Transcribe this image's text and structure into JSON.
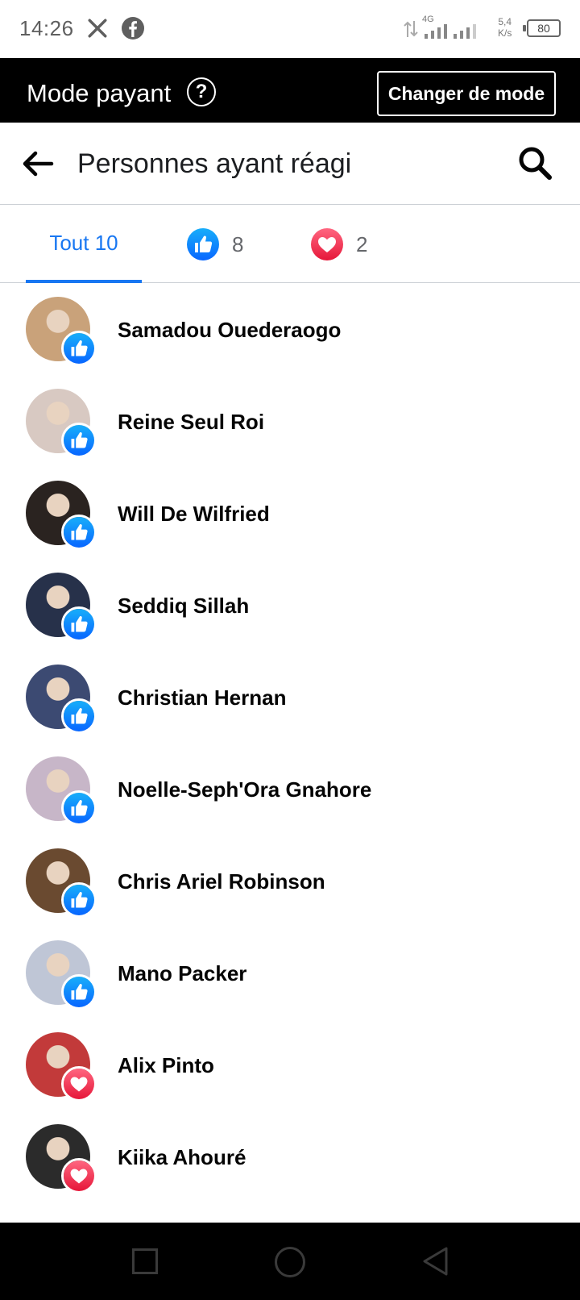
{
  "status_bar": {
    "time": "14:26",
    "network": "4G",
    "speed_value": "5,4",
    "speed_unit": "K/s",
    "battery": "80"
  },
  "mode_bar": {
    "title": "Mode payant",
    "help_glyph": "?",
    "change_button": "Changer de mode"
  },
  "header": {
    "title": "Personnes ayant réagi"
  },
  "tabs": {
    "all_label": "Tout 10",
    "like_count": "8",
    "love_count": "2"
  },
  "reactors": [
    {
      "name": "Samadou Ouederaogo",
      "reaction": "like",
      "avatar_color": "#c9a27a"
    },
    {
      "name": "Reine Seul Roi",
      "reaction": "like",
      "avatar_color": "#d8c9c2"
    },
    {
      "name": "Will De Wilfried",
      "reaction": "like",
      "avatar_color": "#2a2320"
    },
    {
      "name": "Seddiq Sillah",
      "reaction": "like",
      "avatar_color": "#27314a"
    },
    {
      "name": "Christian Hernan",
      "reaction": "like",
      "avatar_color": "#3c4a72"
    },
    {
      "name": "Noelle-Seph'Ora Gnahore",
      "reaction": "like",
      "avatar_color": "#c7b6c8"
    },
    {
      "name": "Chris Ariel Robinson",
      "reaction": "like",
      "avatar_color": "#6a4a30"
    },
    {
      "name": "Mano Packer",
      "reaction": "like",
      "avatar_color": "#bfc6d6"
    },
    {
      "name": "Alix Pinto",
      "reaction": "love",
      "avatar_color": "#c23a3a"
    },
    {
      "name": "Kiika Ahouré",
      "reaction": "love",
      "avatar_color": "#2b2b2b"
    }
  ],
  "colors": {
    "accent": "#1877f2",
    "love": "#f33e58",
    "mode_bar": "#000000"
  },
  "icons": {
    "x": "x-logo-icon",
    "facebook": "facebook-icon",
    "back": "back-arrow-icon",
    "search": "search-icon",
    "like": "like-reaction-icon",
    "love": "love-reaction-icon"
  }
}
